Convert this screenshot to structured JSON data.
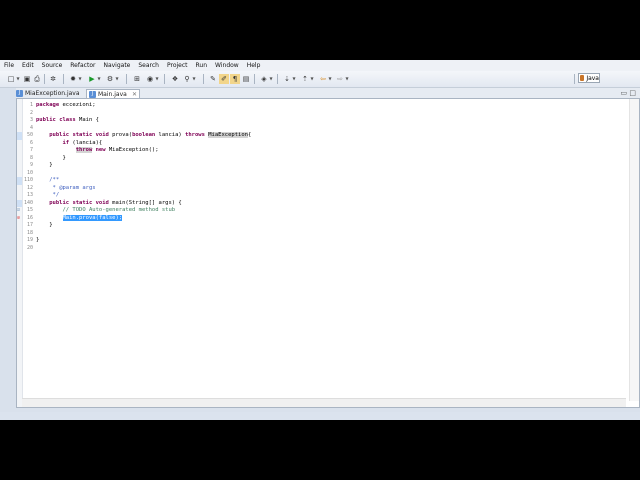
{
  "menu": [
    "File",
    "Edit",
    "Source",
    "Refactor",
    "Navigate",
    "Search",
    "Project",
    "Run",
    "Window",
    "Help"
  ],
  "toolbar": {
    "perspective_label": "Java"
  },
  "tabs": [
    {
      "label": "MiaException.java",
      "active": false
    },
    {
      "label": "Main.java",
      "active": true,
      "close": "✕"
    }
  ],
  "editor": {
    "lines": [
      {
        "n": "1",
        "segments": [
          {
            "t": "package",
            "c": "kw"
          },
          {
            "t": " eccezioni;"
          }
        ]
      },
      {
        "n": "2",
        "segments": []
      },
      {
        "n": "3",
        "segments": [
          {
            "t": "public",
            "c": "kw"
          },
          {
            "t": " "
          },
          {
            "t": "class",
            "c": "kw"
          },
          {
            "t": " Main {"
          }
        ]
      },
      {
        "n": "4",
        "segments": []
      },
      {
        "n": "50",
        "fold": true,
        "segments": [
          {
            "t": "    "
          },
          {
            "t": "public",
            "c": "kw"
          },
          {
            "t": " "
          },
          {
            "t": "static",
            "c": "kw"
          },
          {
            "t": " "
          },
          {
            "t": "void",
            "c": "kw"
          },
          {
            "t": " prova("
          },
          {
            "t": "boolean",
            "c": "kw"
          },
          {
            "t": " lancia) "
          },
          {
            "t": "throws",
            "c": "kw"
          },
          {
            "t": " "
          },
          {
            "t": "MiaException",
            "c": "hl"
          },
          {
            "t": "{"
          }
        ]
      },
      {
        "n": "6",
        "segments": [
          {
            "t": "        "
          },
          {
            "t": "if",
            "c": "kw"
          },
          {
            "t": " (lancia){"
          }
        ]
      },
      {
        "n": "7",
        "segments": [
          {
            "t": "            "
          },
          {
            "t": "throw",
            "c": "kw hl"
          },
          {
            "t": " "
          },
          {
            "t": "new",
            "c": "kw"
          },
          {
            "t": " MiaException();"
          }
        ]
      },
      {
        "n": "8",
        "segments": [
          {
            "t": "        }"
          }
        ]
      },
      {
        "n": "9",
        "segments": [
          {
            "t": "    }"
          }
        ]
      },
      {
        "n": "10",
        "segments": []
      },
      {
        "n": "110",
        "fold": true,
        "segments": [
          {
            "t": "    "
          },
          {
            "t": "/**",
            "c": "jd"
          }
        ]
      },
      {
        "n": "12",
        "segments": [
          {
            "t": "     * ",
            "c": "jd"
          },
          {
            "t": "@param",
            "c": "jd"
          },
          {
            "t": " args",
            "c": "jd"
          }
        ]
      },
      {
        "n": "13",
        "segments": [
          {
            "t": "     */",
            "c": "jd"
          }
        ]
      },
      {
        "n": "140",
        "fold": true,
        "segments": [
          {
            "t": "    "
          },
          {
            "t": "public",
            "c": "kw"
          },
          {
            "t": " "
          },
          {
            "t": "static",
            "c": "kw"
          },
          {
            "t": " "
          },
          {
            "t": "void",
            "c": "kw"
          },
          {
            "t": " main(String[] args) {"
          }
        ]
      },
      {
        "n": "15",
        "marker": "☑",
        "segments": [
          {
            "t": "        "
          },
          {
            "t": "// TODO Auto-generated method stub",
            "c": "cm"
          }
        ]
      },
      {
        "n": "16",
        "marker": "⊘",
        "segments": [
          {
            "t": "        "
          },
          {
            "t": "Main.prova(false);",
            "c": "sel"
          }
        ]
      },
      {
        "n": "17",
        "segments": [
          {
            "t": "    }"
          }
        ]
      },
      {
        "n": "18",
        "segments": []
      },
      {
        "n": "19",
        "segments": [
          {
            "t": "}"
          }
        ]
      },
      {
        "n": "20",
        "segments": []
      }
    ]
  },
  "colors": {
    "keyword": "#7f0055",
    "comment": "#3f7f5f",
    "javadoc": "#3f5fbf",
    "selection": "#3399ff"
  }
}
